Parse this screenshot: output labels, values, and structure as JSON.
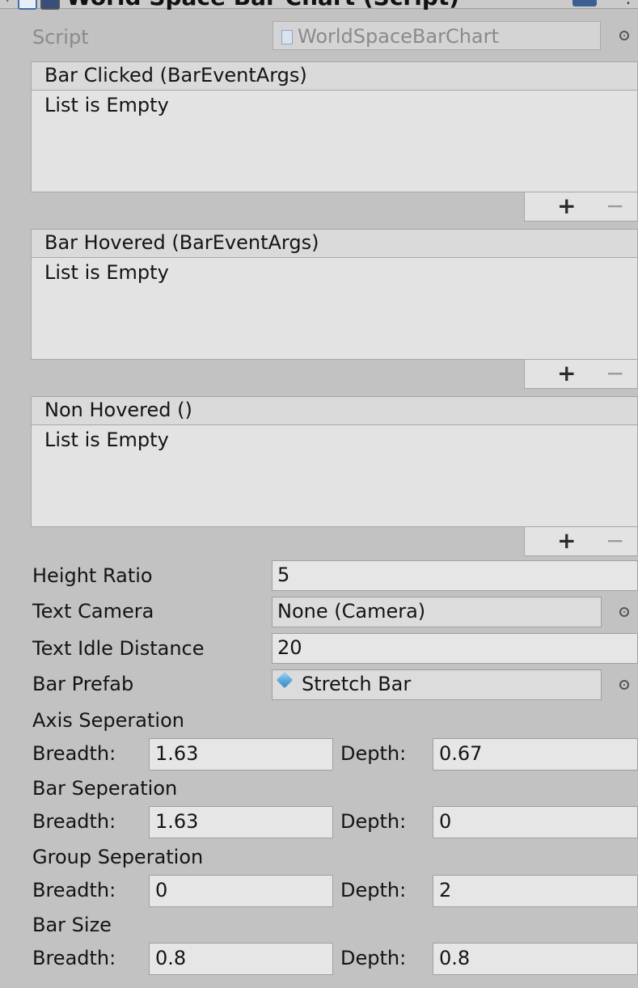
{
  "component": {
    "title": "World Space Bar Chart (Script)"
  },
  "script": {
    "label": "Script",
    "value": "WorldSpaceBarChart"
  },
  "events": [
    {
      "header": "Bar Clicked (BarEventArgs)",
      "empty_text": "List is Empty",
      "add": "+",
      "remove": "−"
    },
    {
      "header": "Bar Hovered (BarEventArgs)",
      "empty_text": "List is Empty",
      "add": "+",
      "remove": "−"
    },
    {
      "header": "Non Hovered ()",
      "empty_text": "List is Empty",
      "add": "+",
      "remove": "−"
    }
  ],
  "properties": {
    "height_ratio": {
      "label": "Height Ratio",
      "value": "5"
    },
    "text_camera": {
      "label": "Text Camera",
      "value": "None (Camera)"
    },
    "text_idle_distance": {
      "label": "Text Idle Distance",
      "value": "20"
    },
    "bar_prefab": {
      "label": "Bar Prefab",
      "value": "Stretch Bar"
    }
  },
  "vector_groups": [
    {
      "label": "Axis Seperation",
      "breadth_label": "Breadth:",
      "breadth": "1.63",
      "depth_label": "Depth:",
      "depth": "0.67"
    },
    {
      "label": "Bar Seperation",
      "breadth_label": "Breadth:",
      "breadth": "1.63",
      "depth_label": "Depth:",
      "depth": "0"
    },
    {
      "label": "Group Seperation",
      "breadth_label": "Breadth:",
      "breadth": "0",
      "depth_label": "Depth:",
      "depth": "2"
    },
    {
      "label": "Bar Size",
      "breadth_label": "Breadth:",
      "breadth": "0.8",
      "depth_label": "Depth:",
      "depth": "0.8"
    }
  ]
}
